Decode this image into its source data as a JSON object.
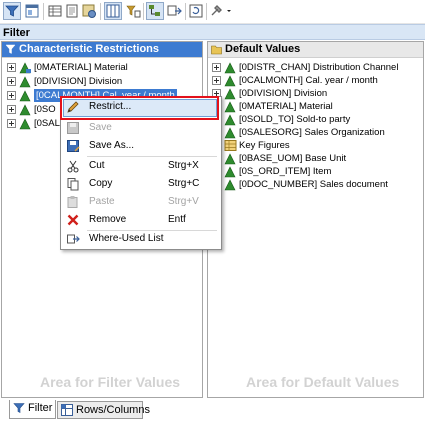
{
  "panel_title": "Filter",
  "left_pane": {
    "title": "Characteristic Restrictions",
    "watermark": "Area for Filter Values",
    "items": [
      {
        "label": "[0MATERIAL] Material"
      },
      {
        "label": "[0DIVISION] Division"
      },
      {
        "label": "[0CALMONTH] Cal. year / month"
      },
      {
        "label": "[0SO"
      },
      {
        "label": "[0SAL"
      }
    ]
  },
  "right_pane": {
    "title": "Default Values",
    "watermark": "Area for Default Values",
    "items": [
      {
        "label": "[0DISTR_CHAN] Distribution Channel"
      },
      {
        "label": "[0CALMONTH] Cal. year / month"
      },
      {
        "label": "[0DIVISION] Division"
      },
      {
        "label": "[0MATERIAL] Material"
      },
      {
        "label": "[0SOLD_TO] Sold-to party"
      },
      {
        "label": "[0SALESORG] Sales Organization"
      },
      {
        "label": "Key Figures"
      },
      {
        "label": "[0BASE_UOM] Base Unit"
      },
      {
        "label": "[0S_ORD_ITEM] Item"
      },
      {
        "label": "[0DOC_NUMBER] Sales document"
      }
    ]
  },
  "context_menu": {
    "restrict": "Restrict...",
    "save": "Save",
    "save_as": "Save As...",
    "cut": "Cut",
    "cut_key": "Strg+X",
    "copy": "Copy",
    "copy_key": "Strg+C",
    "paste": "Paste",
    "paste_key": "Strg+V",
    "remove": "Remove",
    "remove_key": "Entf",
    "where_used": "Where-Used List"
  },
  "tabs": {
    "filter": "Filter",
    "rows_columns": "Rows/Columns"
  },
  "colors": {
    "selection": "#3d7bd1",
    "highlight_box": "#e3111b",
    "header_bg": "#d9e6f5"
  }
}
